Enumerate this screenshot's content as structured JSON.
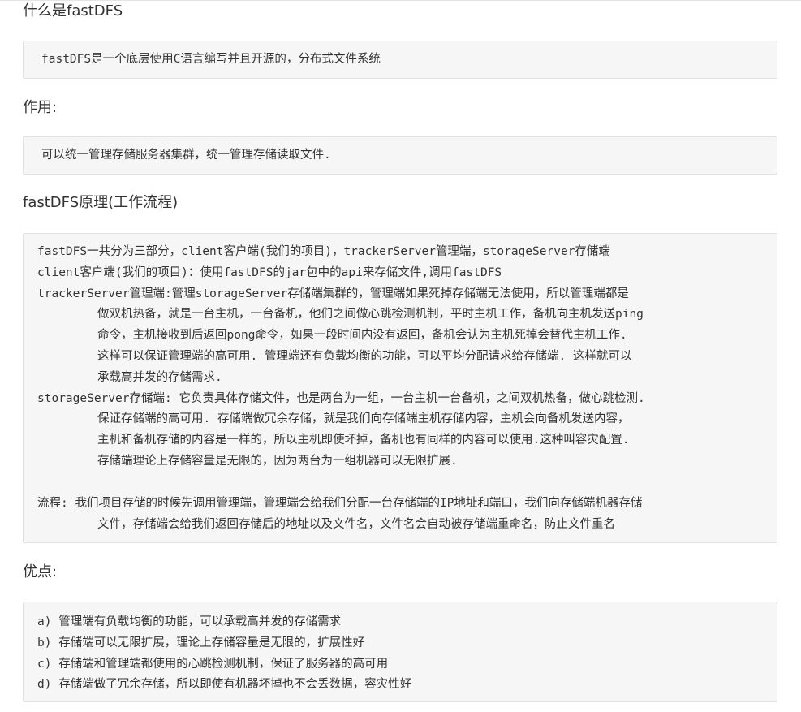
{
  "sections": {
    "what": {
      "heading": "什么是fastDFS",
      "text": "fastDFS是一个底层使用C语言编写并且开源的，分布式文件系统"
    },
    "usage": {
      "heading": "作用:",
      "text": "可以统一管理存储服务器集群，统一管理存储读取文件."
    },
    "principle": {
      "heading": "fastDFS原理(工作流程)",
      "lines": [
        "fastDFS一共分为三部分，client客户端(我们的项目)，trackerServer管理端，storageServer存储端",
        "client客户端(我们的项目)：使用fastDFS的jar包中的api来存储文件,调用fastDFS",
        "trackerServer管理端:管理storageServer存储端集群的，管理端如果死掉存储端无法使用，所以管理端都是",
        "做双机热备，就是一台主机，一台备机，他们之间做心跳检测机制，平时主机工作，备机向主机发送ping",
        "命令，主机接收到后返回pong命令，如果一段时间内没有返回，备机会认为主机死掉会替代主机工作.",
        "这样可以保证管理端的高可用. 管理端还有负载均衡的功能，可以平均分配请求给存储端. 这样就可以",
        "承载高并发的存储需求.",
        "storageServer存储端: 它负责具体存储文件，也是两台为一组，一台主机一台备机，之间双机热备，做心跳检测.",
        "保证存储端的高可用. 存储端做冗余存储，就是我们向存储端主机存储内容，主机会向备机发送内容，",
        "主机和备机存储的内容是一样的，所以主机即使坏掉，备机也有同样的内容可以使用.这种叫容灾配置.",
        "存储端理论上存储容量是无限的，因为两台为一组机器可以无限扩展.",
        "流程: 我们项目存储的时候先调用管理端，管理端会给我们分配一台存储端的IP地址和端口，我们向存储端机器存储",
        "文件，存储端会给我们返回存储后的地址以及文件名，文件名会自动被存储端重命名，防止文件重名"
      ]
    },
    "advantages": {
      "heading": "优点:",
      "lines": [
        "a) 管理端有负载均衡的功能，可以承载高并发的存储需求",
        "b) 存储端可以无限扩展，理论上存储容量是无限的，扩展性好",
        "c) 存储端和管理端都使用的心跳检测机制，保证了服务器的高可用",
        "d) 存储端做了冗余存储，所以即使有机器坏掉也不会丢数据，容灾性好"
      ]
    }
  }
}
